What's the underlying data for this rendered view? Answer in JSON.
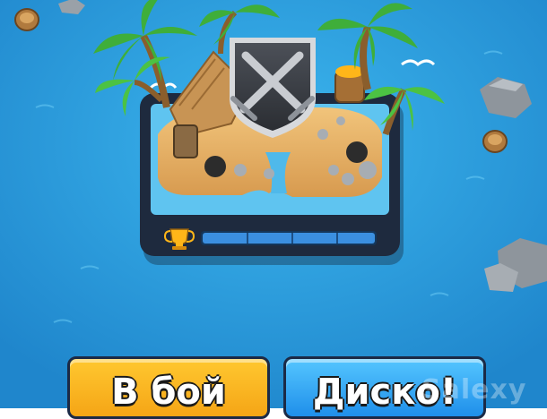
{
  "screen": "battle-tab-arena",
  "arena": {
    "trophy_progress": 0,
    "progress_segments": 4
  },
  "buttons": {
    "battle_label": "В бой",
    "disco_label": "Диско!"
  },
  "watermark": "Salexy",
  "colors": {
    "ocean": "#2a9edb",
    "battle_button": "#f5a516",
    "disco_button": "#1f8fea",
    "progress_bar": "#3b8fe0",
    "frame": "#1e2a3e"
  }
}
